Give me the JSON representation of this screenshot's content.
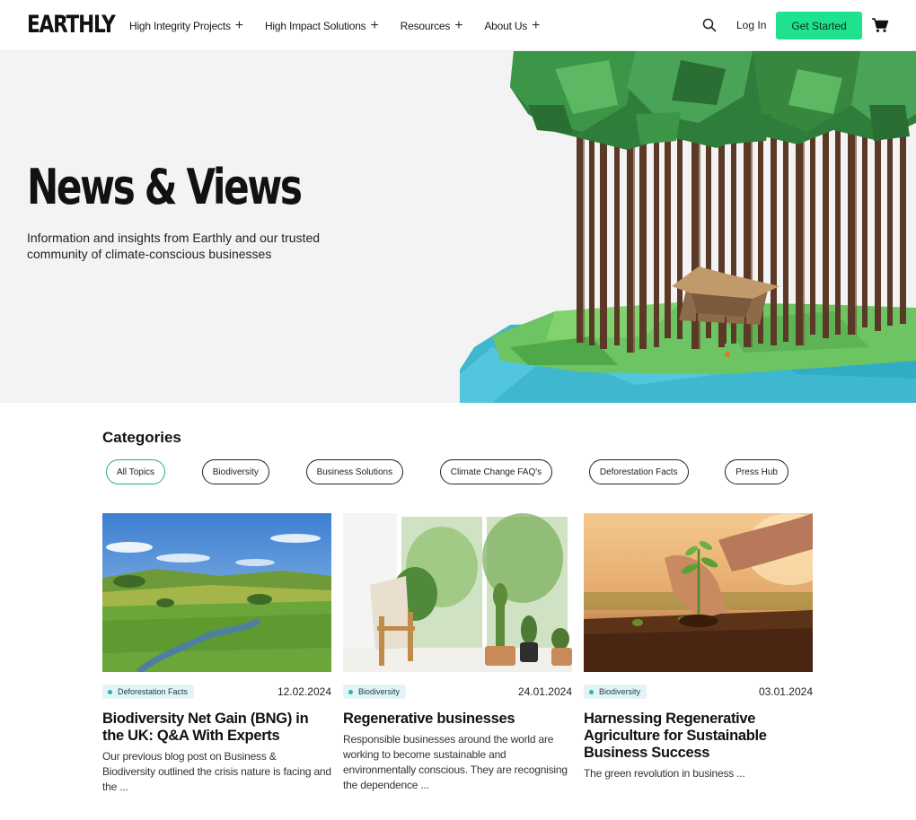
{
  "header": {
    "logo": "EARTHLY",
    "nav": [
      {
        "label": "High Integrity Projects"
      },
      {
        "label": "High Impact Solutions"
      },
      {
        "label": "Resources"
      },
      {
        "label": "About Us"
      }
    ],
    "login_label": "Log In",
    "cta_label": "Get Started",
    "icons": [
      "search-icon",
      "cart-icon",
      "plus-icon"
    ]
  },
  "hero": {
    "title": "News & Views",
    "subtitle": "Information and insights from Earthly and our trusted community of climate-conscious businesses"
  },
  "categories": {
    "heading": "Categories",
    "items": [
      {
        "label": "All Topics",
        "active": true
      },
      {
        "label": "Biodiversity"
      },
      {
        "label": "Business Solutions"
      },
      {
        "label": "Climate Change FAQ's"
      },
      {
        "label": "Deforestation Facts"
      },
      {
        "label": "Press Hub"
      }
    ]
  },
  "posts": [
    {
      "tag": "Deforestation Facts",
      "date": "12.02.2024",
      "title": "Biodiversity Net Gain (BNG) in the UK: Q&A With Experts",
      "excerpt": "Our previous blog post on Business & Biodiversity outlined the crisis nature is facing and the ..."
    },
    {
      "tag": "Biodiversity",
      "date": "24.01.2024",
      "title": "Regenerative businesses",
      "excerpt": "Responsible businesses around the world are working to become sustainable and environmentally conscious. They are recognising the dependence ..."
    },
    {
      "tag": "Biodiversity",
      "date": "03.01.2024",
      "title": "Harnessing Regenerative Agriculture for Sustainable Business Success",
      "excerpt": "The green revolution in business ..."
    }
  ],
  "colors": {
    "accent": "#1fe28f",
    "tag_bg": "#e3f4f6",
    "tag_dot": "#2ab6a8",
    "hero_bg": "#f3f3f3"
  }
}
